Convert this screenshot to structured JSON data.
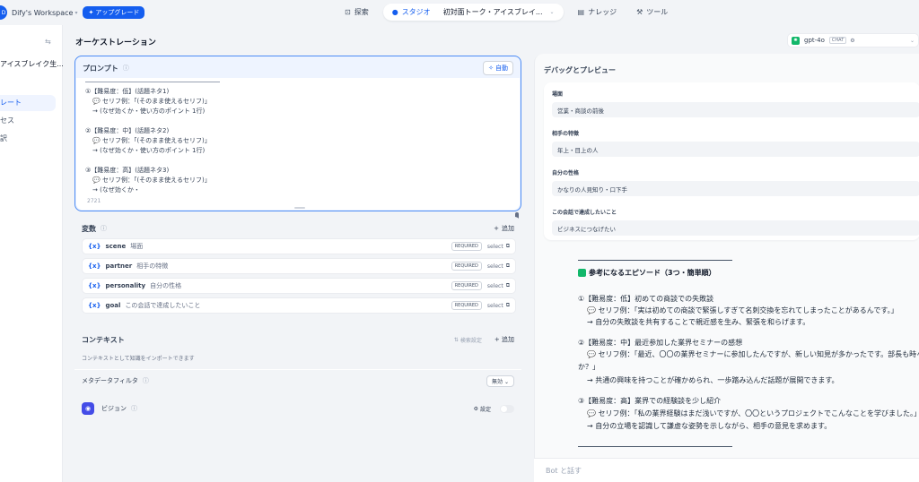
{
  "topbar": {
    "workspace_name": "Dify's Workspace",
    "upgrade_label": "アップグレード",
    "nav": {
      "explore": "探索",
      "studio": "スタジオ",
      "app_name": "初対面トーク・アイスブレイ...",
      "knowledge": "ナレッジ",
      "tools": "ツール"
    }
  },
  "sidebar": {
    "app_title": "アイスブレイク生...",
    "items": [
      {
        "label": "レート"
      },
      {
        "label": "セス"
      },
      {
        "label": "訳"
      }
    ]
  },
  "orchestration_title": "オーケストレーション",
  "prompt": {
    "title": "プロンプト",
    "auto_label": "自動",
    "char_count": "2721",
    "lines": [
      "①【難易度：低】(話題ネタ1)",
      "💬 セリフ例：「(そのまま使えるセリフ)」",
      "→ (なぜ効くか・使い方のポイント 1行)",
      "",
      "②【難易度：中】(話題ネタ2)",
      "💬 セリフ例：「(そのまま使えるセリフ)」",
      "→ (なぜ効くか・使い方のポイント 1行)",
      "",
      "③【難易度：高】(話題ネタ3)",
      "💬 セリフ例：「(そのまま使えるセリフ)」",
      "→ (なぜ効くか・"
    ]
  },
  "variables": {
    "title": "変数",
    "add_label": "追加",
    "items": [
      {
        "key": "scene",
        "label": "場面",
        "badge": "REQUIRED",
        "type": "select"
      },
      {
        "key": "partner",
        "label": "相手の特徴",
        "badge": "REQUIRED",
        "type": "select"
      },
      {
        "key": "personality",
        "label": "自分の性格",
        "badge": "REQUIRED",
        "type": "select"
      },
      {
        "key": "goal",
        "label": "この会話で達成したいこと",
        "badge": "REQUIRED",
        "type": "select"
      }
    ]
  },
  "context": {
    "title": "コンテキスト",
    "retrieval_setting": "検索設定",
    "add_label": "追加",
    "description": "コンテキストとして知識をインポートできます",
    "metadata_filter_label": "メタデータフィルタ",
    "metadata_filter_value": "無効"
  },
  "vision": {
    "title": "ビジョン",
    "setting_label": "設定"
  },
  "model": {
    "name": "gpt-4o",
    "mode": "CHAT"
  },
  "debug": {
    "title": "デバッグとプレビュー",
    "inputs": [
      {
        "label": "場面",
        "value": "営業・商談の前後"
      },
      {
        "label": "相手の特徴",
        "value": "年上・目上の人"
      },
      {
        "label": "自分の性格",
        "value": "かなりの人見知り・口下手"
      },
      {
        "label": "この会話で達成したいこと",
        "value": "ビジネスにつなげたい"
      }
    ],
    "episode_title": "参考になるエピソード（3つ・簡単順）",
    "answer_lines": [
      "①【難易度：低】初めての商談での失敗談",
      "💬 セリフ例：「実は初めての商談で緊張しすぎて名刺交換を忘れてしまったことがあるんです。」",
      "→ 自分の失敗談を共有することで親近感を生み、緊張を和らげます。",
      "②【難易度：中】最近参加した業界セミナーの感想",
      "💬 セリフ例：「最近、〇〇の業界セミナーに参加したんですが、新しい知見が多かったです。部長も時々参加さ",
      "か？」",
      "→ 共通の興味を持つことが確かめられ、一歩踏み込んだ話題が展開できます。",
      "③【難易度：高】業界での経験談を少し紹介",
      "💬 セリフ例：「私の業界経験はまだ浅いですが、〇〇というプロジェクトでこんなことを学びました。」",
      "→ 自分の立場を認識して謙虚な姿勢を示しながら、相手の意見を求めます。"
    ],
    "chat_placeholder": "Bot と話す"
  }
}
